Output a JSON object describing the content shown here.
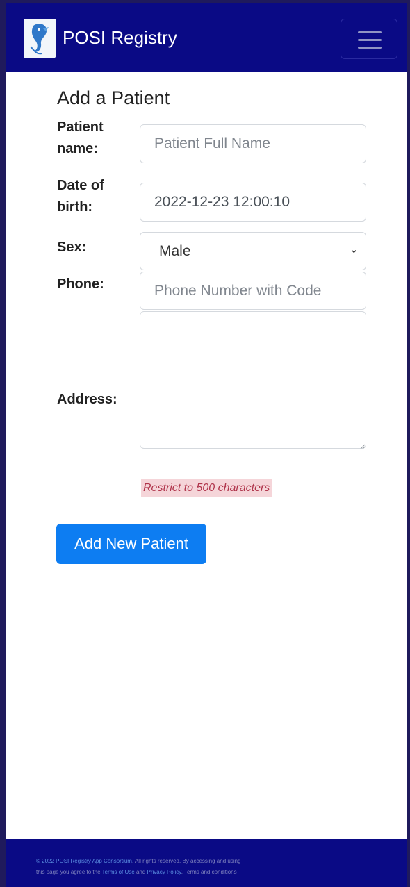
{
  "navbar": {
    "brand": "POSI Registry",
    "menu_icon": "hamburger-menu-icon",
    "background": "#0a0a85"
  },
  "form": {
    "title": "Add a Patient",
    "name_label": "Patient name:",
    "name_placeholder": "Patient Full Name",
    "dob_label": "Date of birth:",
    "dob_value": "2022-12-23 12:00:10",
    "sex_label": "Sex:",
    "sex_value": "Male",
    "phone_label": "Phone:",
    "phone_placeholder": "Phone Number with Code",
    "address_label": "Address:",
    "address_hint": "Restrict to 500 characters",
    "submit_label": "Add New Patient",
    "submit_color": "#0d7df2"
  },
  "footer": {
    "line1_a": "© 2022 POSI Registry App Consortium",
    "line1_b": ". All rights reserved. By accessing and using",
    "line2_a": "this page you agree to the ",
    "line2_link1": "Terms of Use",
    "line2_b": " and ",
    "line2_link2": "Privacy Policy",
    "line2_c": ". Terms and conditions"
  }
}
